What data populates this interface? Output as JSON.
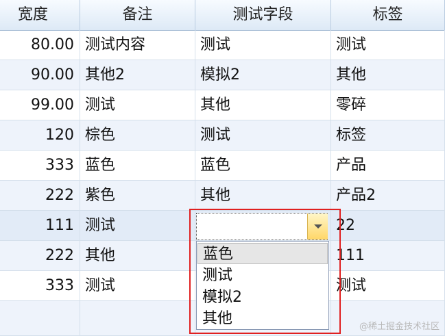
{
  "columns": [
    "宽度",
    "备注",
    "测试字段",
    "标签"
  ],
  "rows": [
    {
      "width": "80.00",
      "remark": "测试内容",
      "field": "测试",
      "tag": "测试"
    },
    {
      "width": "90.00",
      "remark": "其他2",
      "field": "模拟2",
      "tag": "其他"
    },
    {
      "width": "99.00",
      "remark": "测试",
      "field": "其他",
      "tag": "零碎"
    },
    {
      "width": "120",
      "remark": "棕色",
      "field": "测试",
      "tag": "标签"
    },
    {
      "width": "333",
      "remark": "蓝色",
      "field": "蓝色",
      "tag": "产品"
    },
    {
      "width": "222",
      "remark": "紫色",
      "field": "其他",
      "tag": "产品2"
    },
    {
      "width": "111",
      "remark": "测试",
      "field": "",
      "tag": "22"
    },
    {
      "width": "222",
      "remark": "其他",
      "field": "",
      "tag": "111"
    },
    {
      "width": "333",
      "remark": "测试",
      "field": "",
      "tag": "测试"
    }
  ],
  "editor": {
    "value": "",
    "dropdown_icon": "chevron-down-icon"
  },
  "dropdown_options": [
    "蓝色",
    "测试",
    "模拟2",
    "其他"
  ],
  "watermark": "@稀土掘金技术社区",
  "colors": {
    "highlight_border": "#e02020",
    "dropdown_button": "#ffd768"
  }
}
